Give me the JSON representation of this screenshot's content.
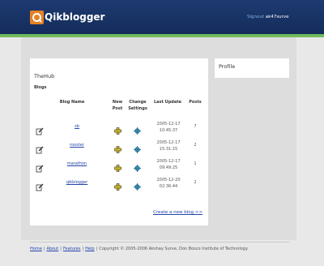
{
  "header": {
    "logo_text": "Qikblogger",
    "signout_label": "Signout",
    "username": "ak47surve"
  },
  "hub": {
    "title": "TheHub",
    "subtitle": "Blogs",
    "columns": {
      "name": "Blog Name",
      "new_post": "New Post",
      "change_settings": "Change Settings",
      "last_update": "Last Update",
      "posts": "Posts"
    },
    "blogs": [
      {
        "name": "sb",
        "updated_date": "2005-12-17",
        "updated_time": "10:45:37",
        "posts": "7"
      },
      {
        "name": "rooster",
        "updated_date": "2005-12-17",
        "updated_time": "15:31:15",
        "posts": "2"
      },
      {
        "name": "marathon",
        "updated_date": "2005-12-17",
        "updated_time": "09:49:25",
        "posts": "1"
      },
      {
        "name": "qikblogger",
        "updated_date": "2005-12-20",
        "updated_time": "02:36:44",
        "posts": "2"
      }
    ],
    "create_link": "Create a new blog >>"
  },
  "profile": {
    "title": "Profile"
  },
  "footer": {
    "links": [
      "Home",
      "About",
      "Features",
      "Help"
    ],
    "copyright": "Copyright © 2005-2006 Akshay Surve, Don Bosco Institute of Technology"
  },
  "colors": {
    "header_bg": "#1e3a70",
    "accent_stripe": "#6fb95d",
    "logo_orange": "#e58224",
    "link": "#2244aa"
  }
}
